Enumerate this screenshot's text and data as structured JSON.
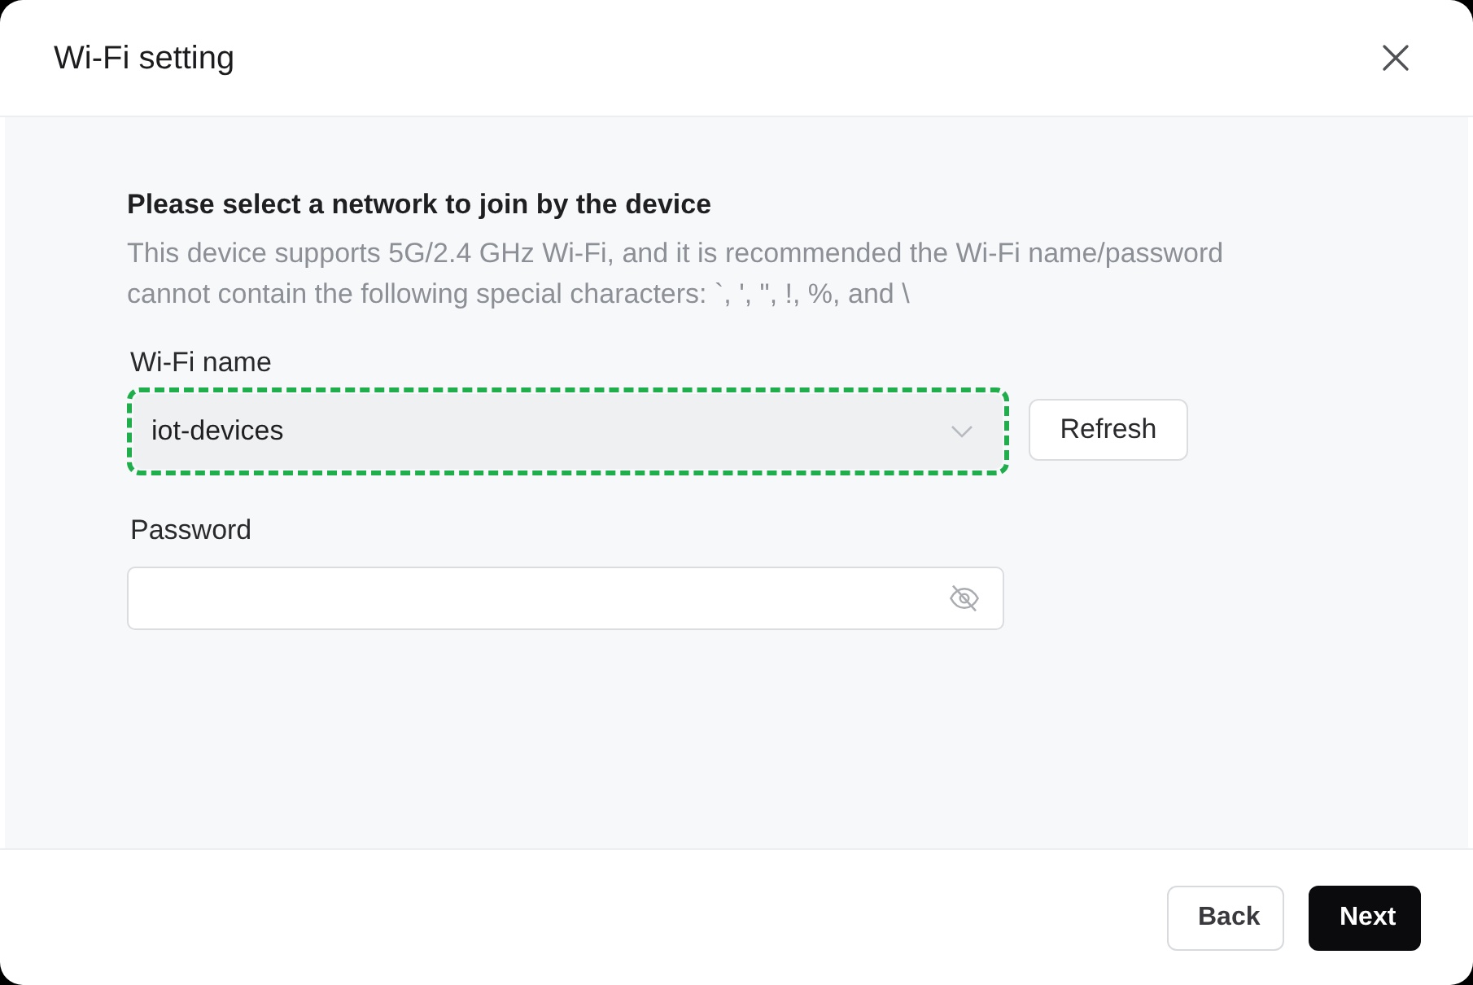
{
  "dialog": {
    "title": "Wi-Fi setting"
  },
  "intro": {
    "heading": "Please select a network to join by the device",
    "description": "This device supports 5G/2.4 GHz Wi-Fi, and it is recommended the Wi-Fi name/password cannot contain the following special characters: `, ', \", !, %, and \\"
  },
  "fields": [
    {
      "kind": "select",
      "label": "Wi-Fi name",
      "value": "iot-devices",
      "highlighted": true,
      "button": "Refresh"
    },
    {
      "kind": "password",
      "label": "Password",
      "password_visible": false
    }
  ],
  "buttons": [
    {
      "label": "Back",
      "kind": "secondary"
    },
    {
      "label": "Next",
      "kind": "primary"
    }
  ]
}
